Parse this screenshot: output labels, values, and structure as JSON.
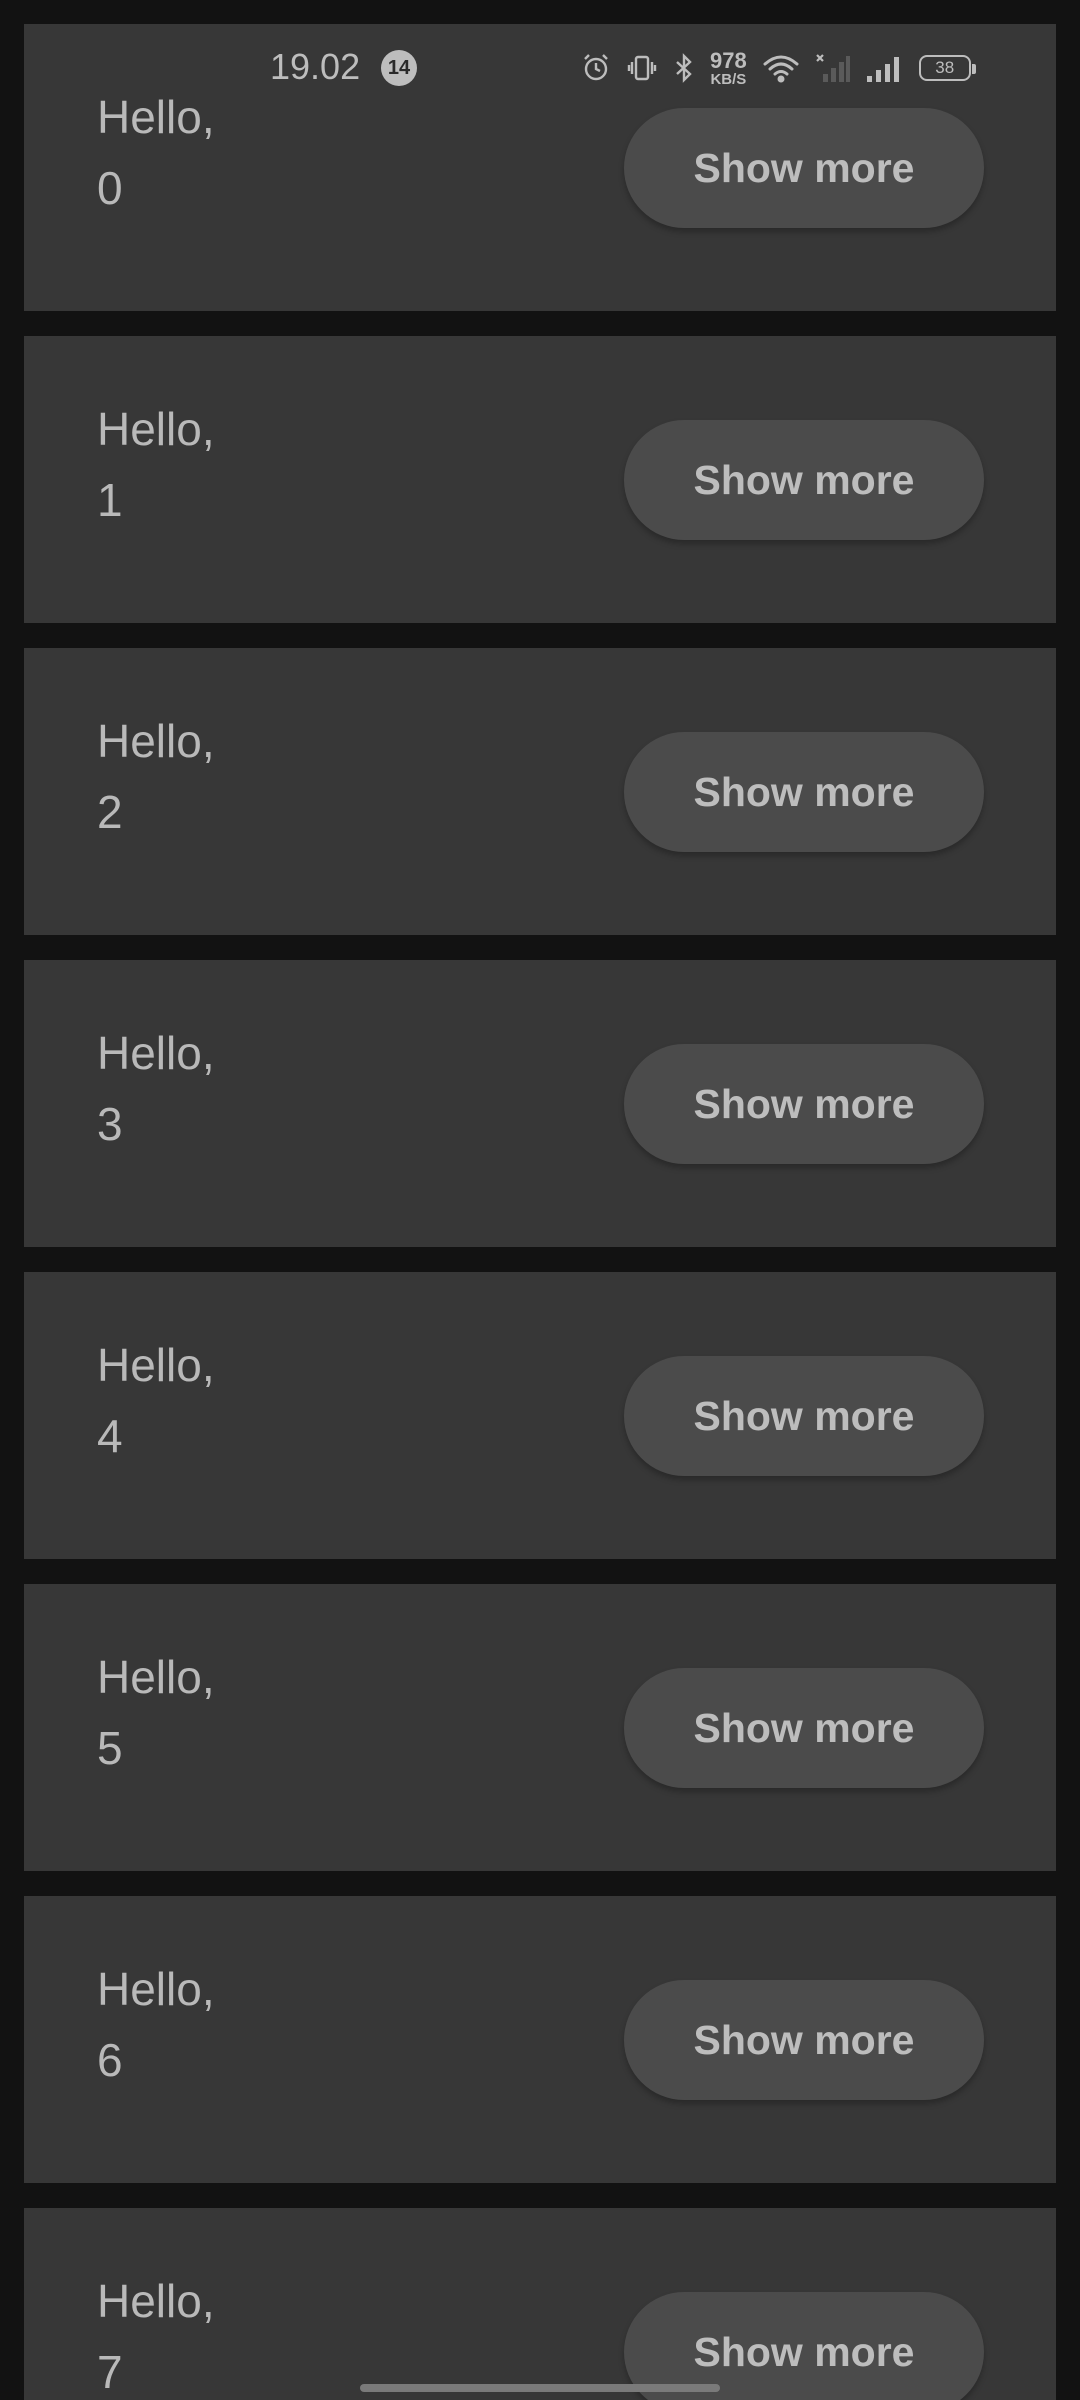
{
  "status_bar": {
    "time": "19.02",
    "notification_count": "14",
    "net_speed_value": "978",
    "net_speed_unit": "KB/S",
    "battery_level": "38",
    "icons": [
      "alarm-icon",
      "vibrate-icon",
      "bluetooth-icon",
      "wifi-icon",
      "signal-sim1-no-service-icon",
      "signal-sim2-icon",
      "battery-icon"
    ]
  },
  "cards": [
    {
      "greeting": "Hello,",
      "number": "0",
      "button": "Show more"
    },
    {
      "greeting": "Hello,",
      "number": "1",
      "button": "Show more"
    },
    {
      "greeting": "Hello,",
      "number": "2",
      "button": "Show more"
    },
    {
      "greeting": "Hello,",
      "number": "3",
      "button": "Show more"
    },
    {
      "greeting": "Hello,",
      "number": "4",
      "button": "Show more"
    },
    {
      "greeting": "Hello,",
      "number": "5",
      "button": "Show more"
    },
    {
      "greeting": "Hello,",
      "number": "6",
      "button": "Show more"
    },
    {
      "greeting": "Hello,",
      "number": "7",
      "button": "Show more"
    }
  ],
  "colors": {
    "background": "#121212",
    "card": "#373737",
    "button": "#4b4b4b",
    "text": "#b9b9b9"
  }
}
